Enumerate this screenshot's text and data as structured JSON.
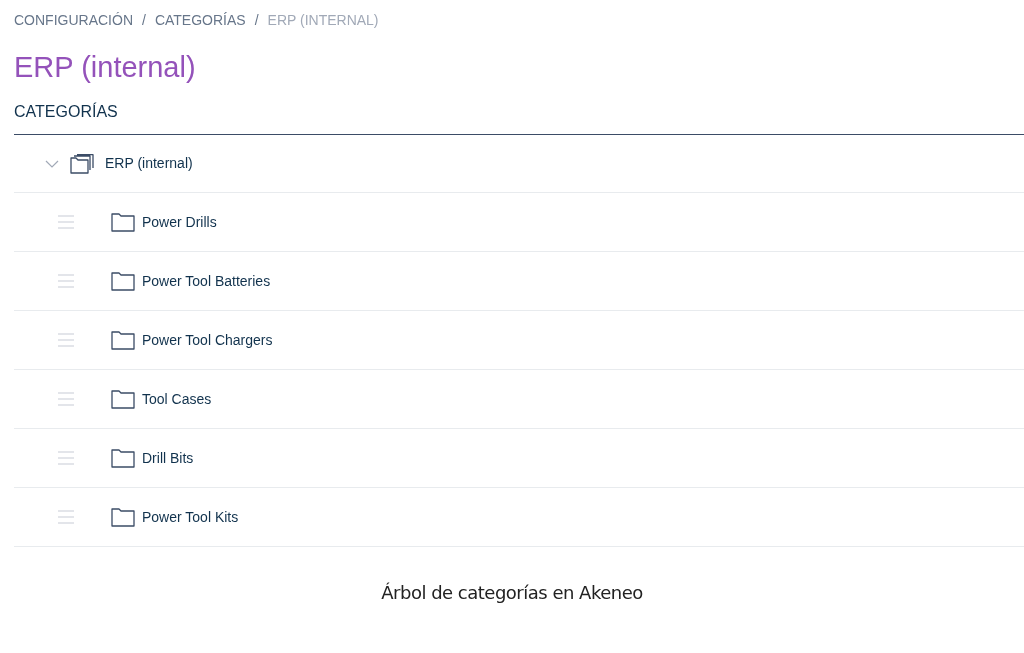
{
  "breadcrumb": [
    {
      "label": "CONFIGURACIÓN",
      "selected": false
    },
    {
      "label": "CATEGORÍAS",
      "selected": false
    },
    {
      "label": "ERP (INTERNAL)",
      "selected": true
    }
  ],
  "separator": "/",
  "title": "ERP (internal)",
  "section_title": "CATEGORÍAS",
  "tree": {
    "label": "ERP (internal)",
    "expanded": true,
    "children": [
      {
        "label": "Power Drills"
      },
      {
        "label": "Power Tool Batteries"
      },
      {
        "label": "Power Tool Chargers"
      },
      {
        "label": "Tool Cases"
      },
      {
        "label": "Drill Bits"
      },
      {
        "label": "Power Tool Kits"
      }
    ]
  },
  "caption": "Árbol de categorías en Akeneo"
}
